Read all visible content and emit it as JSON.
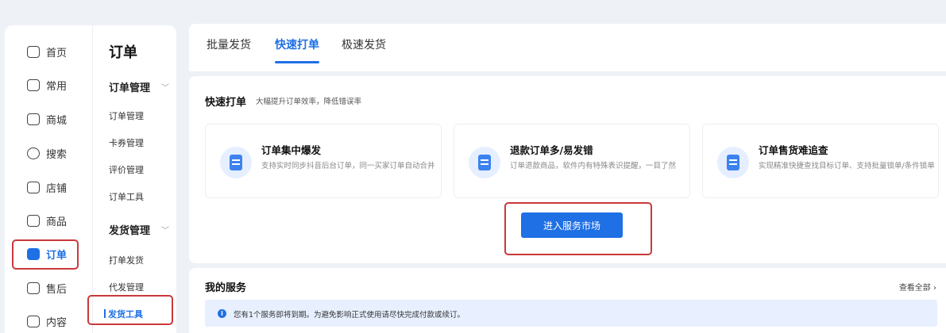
{
  "primary_nav": [
    {
      "label": "首页",
      "icon": "home-icon"
    },
    {
      "label": "常用",
      "icon": "folder-icon"
    },
    {
      "label": "商城",
      "icon": "store-icon"
    },
    {
      "label": "搜索",
      "icon": "search-icon"
    },
    {
      "label": "店铺",
      "icon": "shop-icon"
    },
    {
      "label": "商品",
      "icon": "product-icon"
    },
    {
      "label": "订单",
      "icon": "order-icon",
      "active": true
    },
    {
      "label": "售后",
      "icon": "after-sale-icon"
    },
    {
      "label": "内容",
      "icon": "content-icon"
    }
  ],
  "sub_nav": {
    "title": "订单",
    "groups": [
      {
        "label": "订单管理",
        "items": [
          "订单管理",
          "卡券管理",
          "评价管理",
          "订单工具"
        ]
      },
      {
        "label": "发货管理",
        "items": [
          "打单发货",
          "代发管理",
          "发货工具"
        ]
      }
    ],
    "active_item": "发货工具"
  },
  "tabs": [
    "批量发货",
    "快速打单",
    "极速发货"
  ],
  "active_tab": "快速打单",
  "fast_print": {
    "title": "快速打单",
    "subtitle": "大幅提升订单效率，降低错误率",
    "cards": [
      {
        "title": "订单集中爆发",
        "desc": "支持实时同步抖音后台订单，同一买家订单自动合并",
        "icon": "clipboard-icon"
      },
      {
        "title": "退款订单多/易发错",
        "desc": "订单退款商品，软件内有特殊表识提醒，一目了然",
        "icon": "bag-icon"
      },
      {
        "title": "订单售货难追查",
        "desc": "实现精准快捷查找目标订单、支持批量锁单/条件锁单",
        "icon": "search-doc-icon"
      }
    ],
    "button_label": "进入服务市场"
  },
  "my_services": {
    "title": "我的服务",
    "view_all": "查看全部 ›",
    "notice_icon": "i",
    "notice": "您有1个服务即将到期。为避免影响正式使用请尽快完成付款或续订。"
  },
  "colors": {
    "accent": "#1f6fe5",
    "highlight": "#c9393a"
  }
}
